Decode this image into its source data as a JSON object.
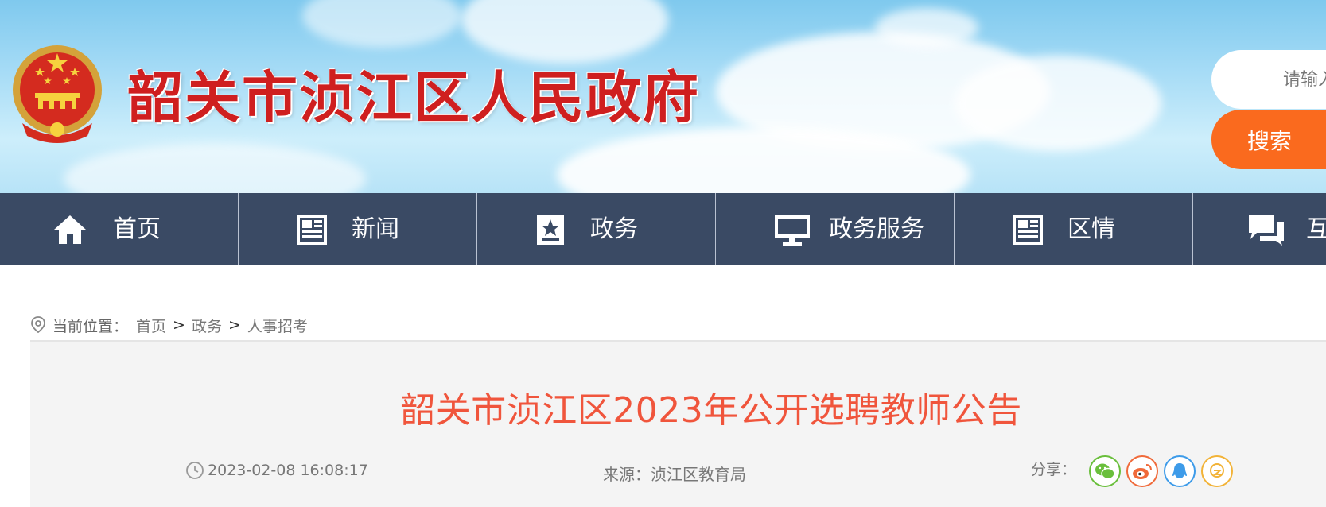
{
  "header": {
    "site_title": "韶关市浈江区人民政府",
    "search_placeholder": "请输入关键字",
    "search_button": "搜索"
  },
  "nav": {
    "items": [
      {
        "label": "首页",
        "icon": "home-icon"
      },
      {
        "label": "新闻",
        "icon": "newspaper-icon"
      },
      {
        "label": "政务",
        "icon": "star-document-icon"
      },
      {
        "label": "政务服务",
        "icon": "monitor-icon"
      },
      {
        "label": "区情",
        "icon": "newspaper-icon"
      },
      {
        "label": "互",
        "icon": "chat-icon"
      }
    ]
  },
  "breadcrumb": {
    "prefix": "当前位置：",
    "items": [
      "首页",
      "政务",
      "人事招考"
    ],
    "separator": ">"
  },
  "article": {
    "title": "韶关市浈江区2023年公开选聘教师公告",
    "date": "2023-02-08 16:08:17",
    "source": "来源：浈江区教育局",
    "share_label": "分享："
  },
  "share_icons": [
    {
      "name": "wechat-icon",
      "color": "#6abf3c"
    },
    {
      "name": "weibo-icon",
      "color": "#f06a3a"
    },
    {
      "name": "qq-icon",
      "color": "#3d9be9"
    },
    {
      "name": "qzone-icon",
      "color": "#f2b338"
    }
  ],
  "colors": {
    "title_red": "#cf1f1f",
    "nav_bg": "#3a4a64",
    "search_orange": "#fa6a1e",
    "article_title": "#f0553c"
  }
}
